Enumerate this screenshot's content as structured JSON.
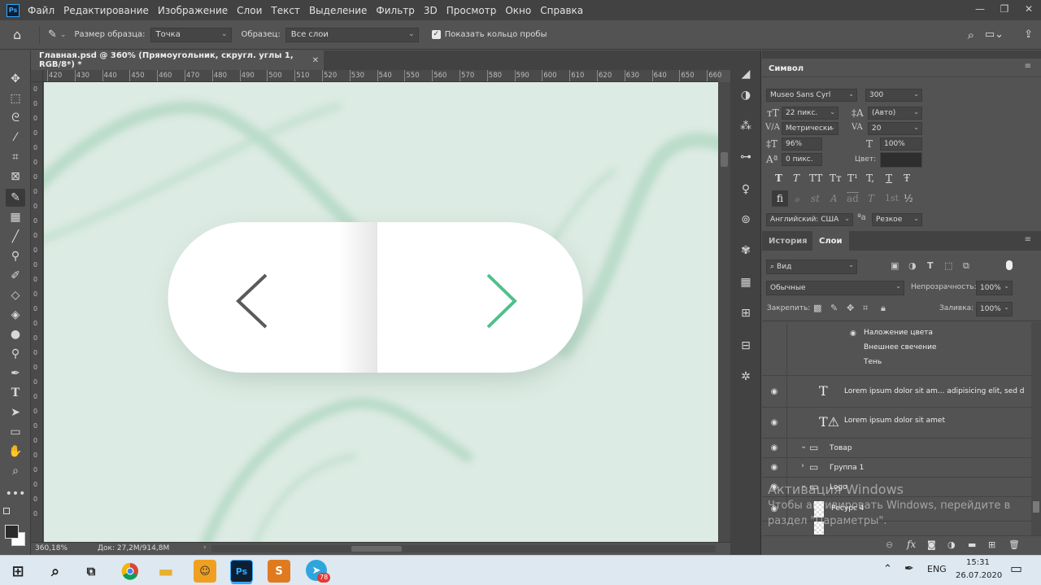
{
  "app": {
    "logo": "Ps"
  },
  "menu": [
    "Файл",
    "Редактирование",
    "Изображение",
    "Слои",
    "Текст",
    "Выделение",
    "Фильтр",
    "3D",
    "Просмотр",
    "Окно",
    "Справка"
  ],
  "options": {
    "sample_size_label": "Размер образца:",
    "sample_size_value": "Точка",
    "sample_label": "Образец:",
    "sample_value": "Все слои",
    "show_ring_label": "Показать кольцо пробы"
  },
  "document": {
    "tab_title": "Главная.psd @ 360% (Прямоугольник, скругл. углы 1, RGB/8*) *",
    "zoom": "360,18%",
    "doc_info": "Док: 27,2M/914,8M"
  },
  "ruler_labels": [
    "420",
    "430",
    "440",
    "450",
    "460",
    "470",
    "480",
    "490",
    "500",
    "510",
    "520",
    "530",
    "540",
    "550",
    "560",
    "570",
    "580",
    "590",
    "600",
    "610",
    "620",
    "630",
    "640",
    "650",
    "660"
  ],
  "ruler_v_labels": [
    "0",
    "0",
    "0",
    "0",
    "0",
    "0",
    "0",
    "0",
    "0",
    "0",
    "0",
    "0",
    "0",
    "0",
    "0",
    "0",
    "0",
    "0",
    "0",
    "0",
    "0",
    "0",
    "0",
    "0",
    "0",
    "0",
    "0",
    "0",
    "0",
    "0"
  ],
  "character_panel": {
    "title": "Символ",
    "font_family": "Museo Sans Cyrl",
    "font_weight": "300",
    "font_size": "22 пикс.",
    "leading": "(Авто)",
    "kerning": "Метрически",
    "tracking": "20",
    "vertical_scale": "96%",
    "horizontal_scale": "100%",
    "baseline_shift": "0 пикс.",
    "color_label": "Цвет:",
    "language": "Английский: США",
    "antialias": "Резкое",
    "text_style_buttons": [
      "T",
      "T",
      "TT",
      "Tт",
      "T¹",
      "T,",
      "T",
      "Ŧ"
    ],
    "opentype_buttons": [
      "fi",
      "ℴ",
      "st",
      "A",
      "ad",
      "T",
      "1st",
      "½"
    ]
  },
  "layers_panel": {
    "tab_history": "История",
    "tab_layers": "Слои",
    "filter_kind": "Вид",
    "blend_mode": "Обычные",
    "opacity_label": "Непрозрачность:",
    "opacity_value": "100%",
    "lock_label": "Закрепить:",
    "fill_label": "Заливка:",
    "fill_value": "100%",
    "effects": [
      "Наложение цвета",
      "Внешнее свечение",
      "Тень"
    ],
    "layers": [
      {
        "name": "Lorem ipsum dolor sit am... adipisicing elit, sed d",
        "type": "text"
      },
      {
        "name": "Lorem ipsum dolor sit amet",
        "type": "text-warn"
      },
      {
        "name": "Товар",
        "type": "group-open"
      },
      {
        "name": "Группа 1",
        "type": "group-closed"
      },
      {
        "name": "Logo",
        "type": "group-open"
      },
      {
        "name": "Ресурс 4",
        "type": "smart"
      }
    ]
  },
  "watermark": {
    "title": "Активация Windows",
    "line1": "Чтобы активировать Windows, перейдите в",
    "line2": "раздел \"Параметры\"."
  },
  "taskbar": {
    "language": "ENG",
    "time": "15:31",
    "date": "26.07.2020",
    "telegram_badge": "78"
  }
}
